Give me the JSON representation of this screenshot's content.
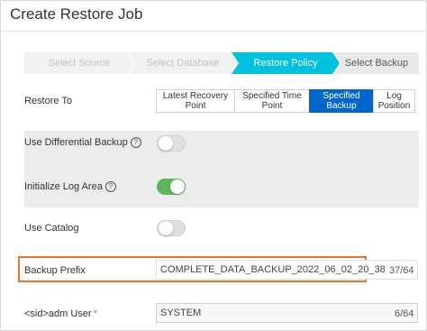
{
  "window": {
    "title": "Create Restore Job"
  },
  "steps": [
    {
      "label": "Select Source",
      "state": "done"
    },
    {
      "label": "Select Database",
      "state": "done"
    },
    {
      "label": "Restore Policy",
      "state": "active"
    },
    {
      "label": "Select Backup",
      "state": "todo"
    }
  ],
  "restore_to": {
    "label": "Restore To",
    "options": [
      {
        "line1": "Latest Recovery",
        "line2": "Point"
      },
      {
        "line1": "Specified Time",
        "line2": "Point"
      },
      {
        "line1": "Specified",
        "line2": "Backup"
      },
      {
        "line1": "Log",
        "line2": "Position"
      }
    ],
    "selected": "Specified Backup"
  },
  "differential_backup": {
    "label": "Use Differential Backup",
    "enabled": false
  },
  "initialize_log_area": {
    "label": "Initialize Log Area",
    "enabled": true
  },
  "use_catalog": {
    "label": "Use Catalog",
    "enabled": false
  },
  "backup_prefix": {
    "label": "Backup Prefix",
    "value": "COMPLETE_DATA_BACKUP_2022_06_02_20_38",
    "counter": "37/64"
  },
  "adm_user": {
    "label": "<sid>adm User",
    "required_mark": "*",
    "value": "SYSTEM",
    "counter": "6/64"
  },
  "colors": {
    "active_step": "#00c1de",
    "selected_option": "#0066cc",
    "toggle_on": "#5cb85c",
    "highlight": "#e8742b",
    "required": "#e84b3a"
  }
}
